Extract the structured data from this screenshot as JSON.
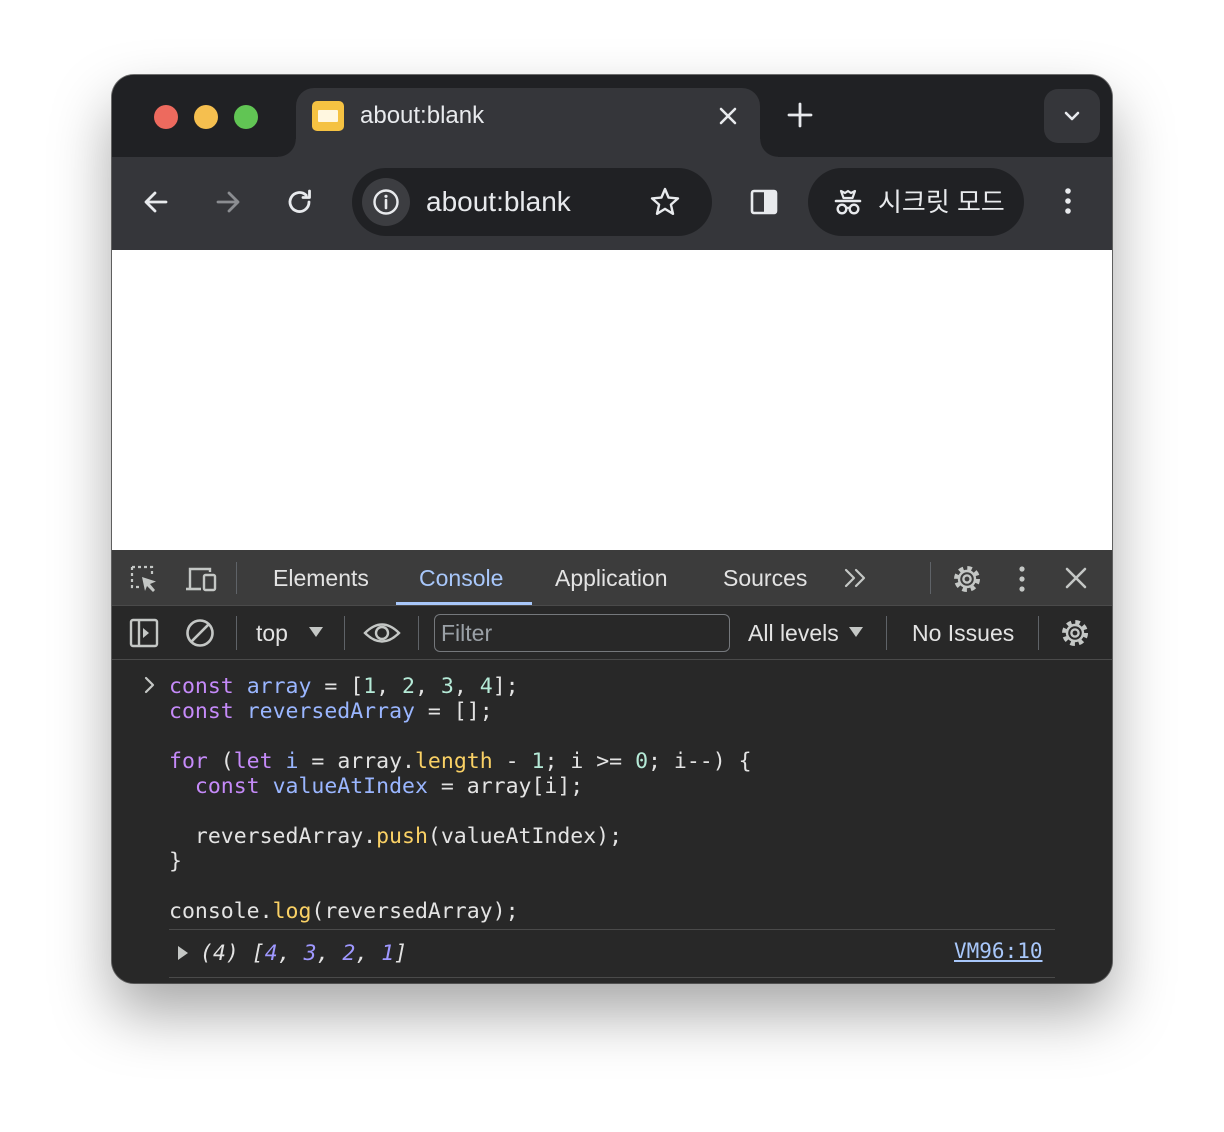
{
  "browser": {
    "tab_title": "about:blank",
    "url": "about:blank",
    "incognito_label": "시크릿 모드"
  },
  "devtools": {
    "tabs": [
      "Elements",
      "Console",
      "Application",
      "Sources"
    ],
    "active_tab": "Console",
    "console_toolbar": {
      "context": "top",
      "filter_placeholder": "Filter",
      "levels": "All levels",
      "issues": "No Issues"
    }
  },
  "console": {
    "code_lines": [
      "const array = [1, 2, 3, 4];",
      "const reversedArray = [];",
      "",
      "for (let i = array.length - 1; i >= 0; i--) {",
      "  const valueAtIndex = array[i];",
      "",
      "  reversedArray.push(valueAtIndex);",
      "}",
      "",
      "console.log(reversedArray);"
    ],
    "output": {
      "length": "(4)",
      "values": [
        "4",
        "3",
        "2",
        "1"
      ],
      "source": "VM96:10"
    }
  },
  "colors": {
    "keyword": "#c58af9",
    "variable": "#9ab6ff",
    "number": "#b5ead7",
    "property": "#fad165",
    "link": "#a8c7fa"
  }
}
